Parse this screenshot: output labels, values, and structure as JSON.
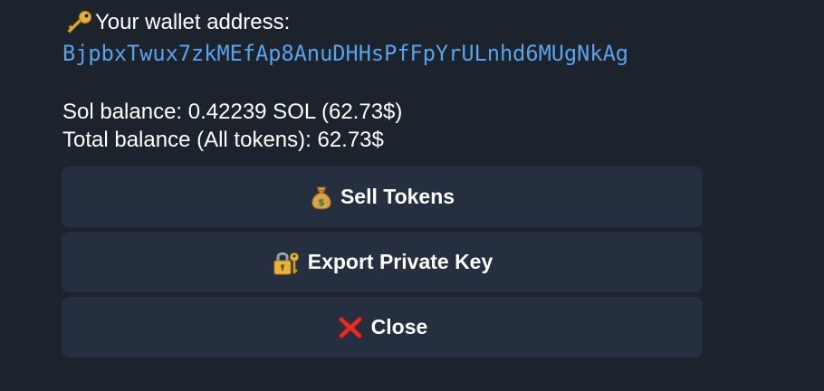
{
  "wallet": {
    "title": "Your wallet address:",
    "title_icon": "key-icon",
    "address": "BjpbxTwux7zkMEfAp8AnuDHHsPfFpYrULnhd6MUgNkAg",
    "address_color": "#5aa2ea"
  },
  "balances": {
    "sol_line": "Sol balance: 0.42239 SOL (62.73$)",
    "total_line": "Total balance (All tokens): 62.73$"
  },
  "buttons": {
    "sell": {
      "label": "Sell Tokens",
      "icon": "money-bag-icon"
    },
    "export": {
      "label": "Export Private Key",
      "icon": "locked-with-key-icon"
    },
    "close": {
      "label": "Close",
      "icon": "cross-mark-icon"
    }
  },
  "colors": {
    "background": "#1c232d",
    "button_background": "#252f3f",
    "text": "#ffffff"
  }
}
